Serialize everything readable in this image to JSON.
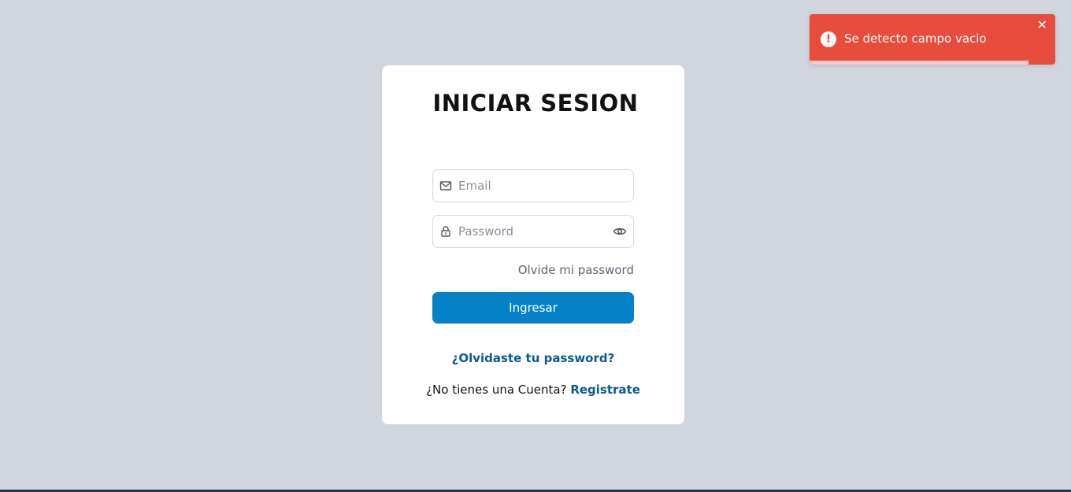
{
  "login": {
    "title": "INICIAR SESION",
    "email_placeholder": "Email",
    "password_placeholder": "Password",
    "forgot_right": "Olvide mi password",
    "submit_label": "Ingresar",
    "forgot_center": "¿Olvidaste tu password?",
    "no_account_text": "¿No tienes una Cuenta?",
    "register_link": "Registrate"
  },
  "toast": {
    "message": "Se detecto campo vacio",
    "close_symbol": "✕",
    "alert_symbol": "!",
    "progress_fraction": 0.89
  },
  "colors": {
    "background": "#d1d5de",
    "primary_button": "#0481c7",
    "link": "#0b5a8c",
    "toast_error": "#e74c3c"
  },
  "icons": {
    "email": "mail-icon",
    "password": "lock-icon",
    "visibility": "eye-icon",
    "toast": "alert-circle-icon"
  }
}
